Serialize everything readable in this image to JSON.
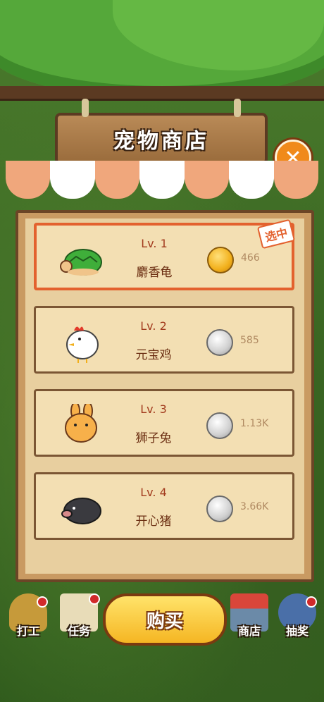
{
  "shop": {
    "title": "宠物商店",
    "close_icon": "close-icon",
    "selected_badge": "选中",
    "pets": [
      {
        "level": "Lv. 1",
        "name": "麝香龟",
        "coin": "gold",
        "price": "466",
        "icon": "turtle-icon",
        "selected": true
      },
      {
        "level": "Lv. 2",
        "name": "元宝鸡",
        "coin": "silver",
        "price": "585",
        "icon": "chicken-icon",
        "selected": false
      },
      {
        "level": "Lv. 3",
        "name": "狮子兔",
        "coin": "silver",
        "price": "1.13K",
        "icon": "rabbit-icon",
        "selected": false
      },
      {
        "level": "Lv. 4",
        "name": "开心猪",
        "coin": "silver",
        "price": "3.66K",
        "icon": "boar-icon",
        "selected": false
      }
    ]
  },
  "bottom_nav": {
    "work": {
      "label": "打工",
      "icon": "miner-helmet-icon"
    },
    "tasks": {
      "label": "任务",
      "icon": "scroll-icon"
    },
    "buy_label": "购买",
    "store": {
      "label": "商店",
      "icon": "store-icon"
    },
    "lottery": {
      "label": "抽奖",
      "icon": "magnifier-icon"
    }
  },
  "colors": {
    "selected_border": "#e3612e",
    "level_text": "#a23b1e",
    "price_text": "#b08a62",
    "buy_button": "#f5b623"
  }
}
